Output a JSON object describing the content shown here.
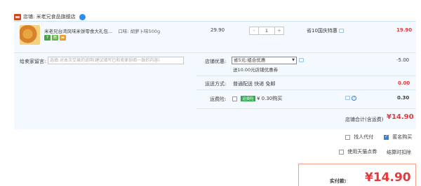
{
  "shop": {
    "label": "店铺: 米老兄食品旗舰店"
  },
  "item": {
    "name": "米老兄台湾风味米饼零食大礼包...",
    "attr": "口味: 胡萝卜味500g",
    "price": "29.90",
    "quantity": "1",
    "decrement": "-",
    "increment": "+",
    "promo": "省10国庆特惠",
    "subtotal": "19.90",
    "badges": [
      "7",
      "赠",
      "▬"
    ]
  },
  "message": {
    "label": "给卖家留言:",
    "placeholder": "选填:对本次交易的说明(建议填写已和卖家协商一致的内容)"
  },
  "coupon": {
    "label": "店铺优惠:",
    "selected": "省5元:组合优惠",
    "note": "送10.00元店铺优惠券",
    "amount": "-5.00"
  },
  "shipping": {
    "label": "运送方式:",
    "value": "普通配送 快递 免邮",
    "amount": "0.00"
  },
  "insurance": {
    "label": "运费险:",
    "tag": "运费险",
    "value": "¥ 0.30购买",
    "amount": "0.30",
    "help": "?"
  },
  "shop_total": {
    "label": "店铺合计(含运费)",
    "value": "¥14.90"
  },
  "options": {
    "proxy_pay": "找人代付",
    "anonymous": "匿名购买",
    "tmall_points": "使用天猫点券",
    "points_note": "结算时扣除"
  },
  "actual": {
    "label": "实付款:",
    "value": "¥14.90"
  }
}
